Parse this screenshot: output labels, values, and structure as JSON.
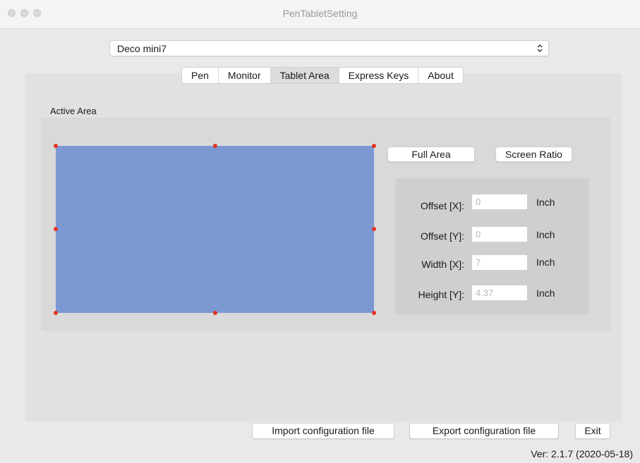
{
  "window": {
    "title": "PenTabletSetting"
  },
  "device": {
    "selected": "Deco mini7"
  },
  "tabs": [
    {
      "label": "Pen"
    },
    {
      "label": "Monitor"
    },
    {
      "label": "Tablet Area",
      "selected": true
    },
    {
      "label": "Express Keys"
    },
    {
      "label": "About"
    }
  ],
  "active_area": {
    "label": "Active Area",
    "rect_color": "#7b98d3",
    "handle_color": "#e53323"
  },
  "buttons": {
    "full_area": "Full Area",
    "screen_ratio": "Screen Ratio",
    "import": "Import configuration file",
    "export": "Export configuration file",
    "exit": "Exit"
  },
  "fields": {
    "offset_x": {
      "label": "Offset [X]:",
      "value": "0",
      "unit": "Inch"
    },
    "offset_y": {
      "label": "Offset [Y]:",
      "value": "0",
      "unit": "Inch"
    },
    "width_x": {
      "label": "Width [X]:",
      "value": "7",
      "unit": "Inch"
    },
    "height_y": {
      "label": "Height [Y]:",
      "value": "4.37",
      "unit": "Inch"
    }
  },
  "version": "Ver: 2.1.7 (2020-05-18)"
}
